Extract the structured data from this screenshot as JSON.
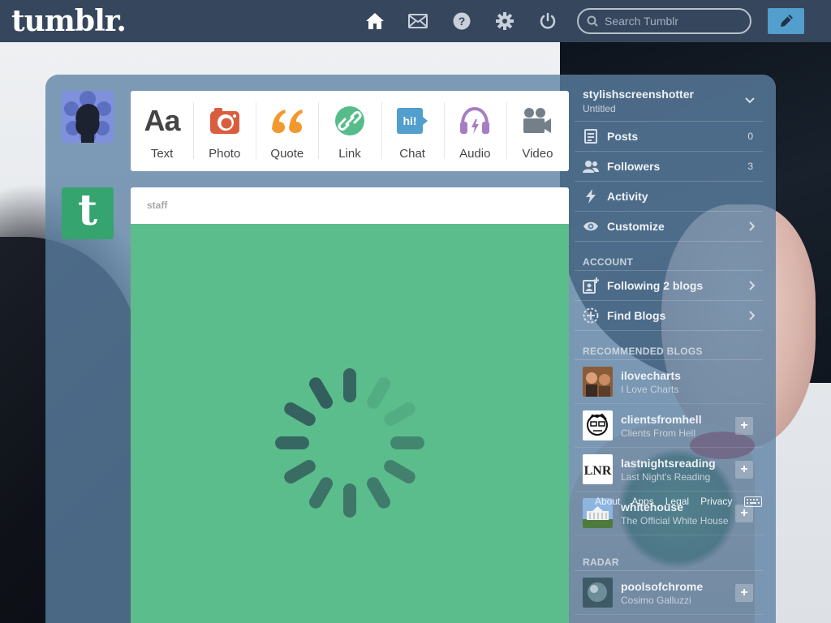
{
  "header": {
    "logo": "tumblr.",
    "search_placeholder": "Search Tumblr",
    "icons": [
      "home-icon",
      "mail-icon",
      "help-icon",
      "gear-icon",
      "power-icon"
    ],
    "compose_icon": "pencil-icon",
    "bg_color": "#36465d",
    "compose_color": "#529ecc"
  },
  "post_types": [
    {
      "label": "Text",
      "icon": "text-icon",
      "color": "#444444"
    },
    {
      "label": "Photo",
      "icon": "camera-icon",
      "color": "#d95e40"
    },
    {
      "label": "Quote",
      "icon": "quote-icon",
      "color": "#f2992e"
    },
    {
      "label": "Link",
      "icon": "link-icon",
      "color": "#56bc8a"
    },
    {
      "label": "Chat",
      "icon": "chat-icon",
      "color": "#529ecc"
    },
    {
      "label": "Audio",
      "icon": "headphones-icon",
      "color": "#a77dc2"
    },
    {
      "label": "Video",
      "icon": "video-camera-icon",
      "color": "#748089"
    }
  ],
  "post": {
    "author": "staff",
    "bg_color": "#5bbd8b",
    "avatar_letter": "t"
  },
  "sidebar": {
    "blog_name": "stylishscreenshotter",
    "blog_title": "Untitled",
    "items": [
      {
        "label": "Posts",
        "count": "0",
        "icon": "posts-icon"
      },
      {
        "label": "Followers",
        "count": "3",
        "icon": "followers-icon"
      },
      {
        "label": "Activity",
        "count": "",
        "icon": "activity-icon"
      },
      {
        "label": "Customize",
        "count": "",
        "icon": "eye-icon"
      }
    ],
    "account_title": "ACCOUNT",
    "account_items": [
      {
        "label": "Following 2 blogs",
        "icon": "following-icon"
      },
      {
        "label": "Find Blogs",
        "icon": "find-blogs-icon"
      }
    ],
    "recommended_title": "RECOMMENDED BLOGS",
    "recommended": [
      {
        "name": "ilovecharts",
        "desc": "I Love Charts"
      },
      {
        "name": "clientsfromhell",
        "desc": "Clients From Hell"
      },
      {
        "name": "lastnightsreading",
        "desc": "Last Night's Reading"
      },
      {
        "name": "whitehouse",
        "desc": "The Official White House"
      }
    ],
    "radar_title": "RADAR",
    "radar": [
      {
        "name": "poolsofchrome",
        "desc": "Cosimo Galluzzi"
      }
    ]
  },
  "footer": {
    "links": [
      "About",
      "Apps",
      "Legal",
      "Privacy"
    ]
  }
}
